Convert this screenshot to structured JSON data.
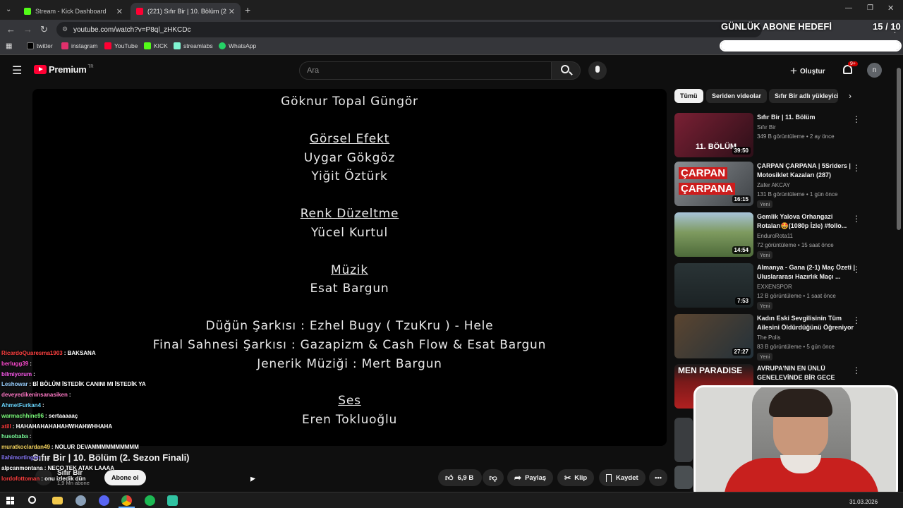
{
  "browser": {
    "tabs": [
      {
        "label": "Stream - Kick Dashboard",
        "active": false,
        "color": "#53fc18"
      },
      {
        "label": "(221) Sıfır Bir | 10. Bölüm (2. Sez",
        "active": true,
        "color": "#ff0033"
      }
    ],
    "url": "youtube.com/watch?v=P8ql_zHKCDc",
    "bookmarks": [
      {
        "label": "twitter",
        "icon": "x-icon",
        "color": "#000000"
      },
      {
        "label": "instagram",
        "icon": "instagram-icon",
        "color": "#e1306c"
      },
      {
        "label": "YouTube",
        "icon": "youtube-icon",
        "color": "#ff0033"
      },
      {
        "label": "KICK",
        "icon": "kick-icon",
        "color": "#53fc18"
      },
      {
        "label": "streamlabs",
        "icon": "streamlabs-icon",
        "color": "#80f5d2"
      },
      {
        "label": "WhatsApp",
        "icon": "whatsapp-icon",
        "color": "#25d366"
      }
    ]
  },
  "youtube": {
    "logo": "Premium",
    "logo_sup": "TR",
    "search_placeholder": "Ara",
    "create_label": "Oluştur",
    "notif_badge": "9+",
    "avatar_letter": "n"
  },
  "video": {
    "credits": [
      {
        "text": "Göknur Topal Güngör",
        "heading": false
      },
      {
        "text": "Görsel Efekt",
        "heading": true
      },
      {
        "text": "Uygar Gökgöz",
        "heading": false
      },
      {
        "text": "Yiğit Öztürk",
        "heading": false
      },
      {
        "text": "Renk Düzeltme",
        "heading": true
      },
      {
        "text": "Yücel Kurtul",
        "heading": false
      },
      {
        "text": "Müzik",
        "heading": true
      },
      {
        "text": "Esat Bargun",
        "heading": false
      },
      {
        "text": "Düğün Şarkısı : Ezhel Bugy ( TzuKru ) - Hele",
        "heading": false
      },
      {
        "text": "Final Sahnesi Şarkısı : Gazapizm & Cash Flow & Esat Bargun",
        "heading": false
      },
      {
        "text": "Jenerik Müziği : Mert Bargun",
        "heading": false
      },
      {
        "text": "Ses",
        "heading": true
      },
      {
        "text": "Eren Tokluoğlu",
        "heading": false
      }
    ],
    "title": "Sıfır Bir | 10. Bölüm (2. Sezon Finali)",
    "channel": "Sıfır Bir",
    "subscribers": "1,9 Mn abone",
    "subscribe_label": "Abone ol",
    "like_count": "6,9 B",
    "share_label": "Paylaş",
    "clip_label": "Klip",
    "save_label": "Kaydet"
  },
  "sidebar": {
    "chips": [
      "Tümü",
      "Seriden videolar",
      "Sıfır Bir adlı yükleyici"
    ],
    "recommendations": [
      {
        "title": "Sıfır Bir | 11. Bölüm",
        "channel": "Sıfır Bir",
        "meta": "349 B görüntüleme • 2 ay önce",
        "duration": "39:50",
        "new": "",
        "thumb_color": "#5b1d2a"
      },
      {
        "title": "ÇARPAN ÇARPANA | 5Sriders | Motosiklet Kazaları (287)",
        "channel": "Zafer AKCAY",
        "meta": "131 B görüntüleme • 1 gün önce",
        "duration": "16:15",
        "new": "Yeni",
        "thumb_color": "#6b6f74"
      },
      {
        "title": "Gemlik Yalova Orhangazi Rotaları🤩(1080p İzle) #follo...",
        "channel": "EnduroRota11",
        "meta": "72 görüntüleme • 15 saat önce",
        "duration": "14:54",
        "new": "Yeni",
        "thumb_color": "#6f8a5a"
      },
      {
        "title": "Almanya - Gana (2-1) Maç Özeti | Uluslararası Hazırlık Maçı ...",
        "channel": "EXXENSPOR",
        "meta": "12 B görüntüleme • 1 saat önce",
        "duration": "7:53",
        "new": "Yeni",
        "thumb_color": "#2f3a3c"
      },
      {
        "title": "Kadın Eski Sevgilisinin Tüm Ailesini Öldürdüğünü Öğreniyor",
        "channel": "The Polis",
        "meta": "83 B görüntüleme • 5 gün önce",
        "duration": "27:27",
        "new": "Yeni",
        "thumb_color": "#4a3b2d"
      },
      {
        "title": "AVRUPA'NIN EN ÜNLÜ GENELEVİNDE BİR GECE",
        "channel": "",
        "meta": "",
        "duration": "",
        "new": "",
        "thumb_color": "#7a1a1a",
        "thumb_text": "MEN PARADISE"
      }
    ]
  },
  "chat": [
    {
      "user": "RicardoQuaresma1903",
      "msg": ": BAKSANA",
      "color": "#ff4040"
    },
    {
      "user": "berlugg39",
      "msg": ":",
      "color": "#ff4dd2"
    },
    {
      "user": "bilmiyorum",
      "msg": ":",
      "color": "#ff5cf0"
    },
    {
      "user": "Leshowar",
      "msg": ": Bİ BÖLÜM İSTEDİK CANINI MI İSTEDİK YA",
      "color": "#9ad0ff"
    },
    {
      "user": "deveyedikeninsanasiken",
      "msg": ":",
      "color": "#ff79c6"
    },
    {
      "user": "AhmetFurkan4",
      "msg": ":",
      "color": "#6bd7ff"
    },
    {
      "user": "warmachhine96",
      "msg": ": sertaaaaaç",
      "color": "#7dff7d"
    },
    {
      "user": "atill",
      "msg": ": HAHAHAHAHAHAHWHAHWHHAHA",
      "color": "#ff3b3b"
    },
    {
      "user": "husobaba",
      "msg": ":",
      "color": "#7cff9d"
    },
    {
      "user": "muratkoclardan49",
      "msg": ": NOLUR DEVAMMMMMMMMMM",
      "color": "#f4d35e"
    },
    {
      "user": "ilahimortingen",
      "msg": ": ...",
      "color": "#8b7bff"
    },
    {
      "user": "alpcanmontana",
      "msg": ": NECO TEK ATAK LAAAA",
      "color": "#ffffff"
    },
    {
      "user": "lordofottoman",
      "msg": ": onu izledik dün",
      "color": "#ff4040"
    }
  ],
  "overlay": {
    "goal_label": "GÜNLÜK ABONE HEDEFİ",
    "goal_count": "15 / 10",
    "goal_fraction": 1.0
  },
  "taskbar": {
    "date": "31.03.2026"
  }
}
